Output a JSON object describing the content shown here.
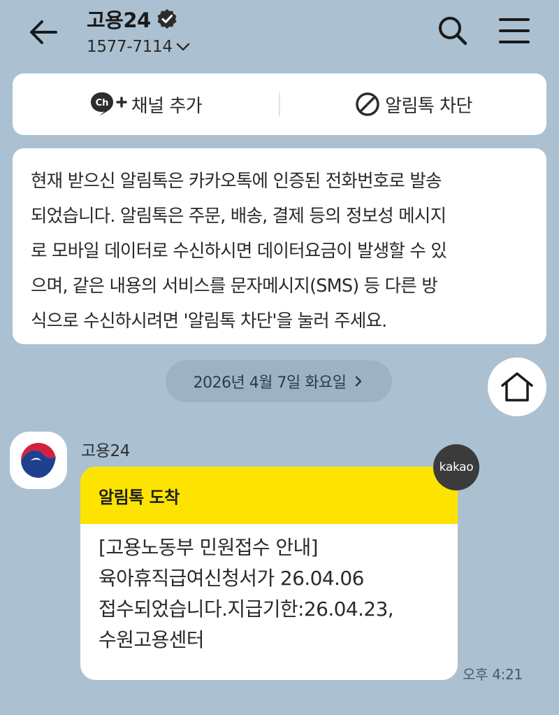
{
  "header": {
    "title": "고용24",
    "phone": "1577-7114"
  },
  "actions": {
    "add_channel": "채널 추가",
    "block": "알림톡 차단",
    "ch_badge": "Ch"
  },
  "notice": {
    "lines": [
      "현재 받으신 알림톡은 카카오톡에 인증된 전화번호로 발송",
      "되었습니다. 알림톡은 주문, 배송, 결제 등의 정보성 메시지",
      "로 모바일 데이터로 수신하시면 데이터요금이 발생할 수 있",
      "으며, 같은 내용의 서비스를 문자메시지(SMS) 등 다른 방",
      "식으로 수신하시려면 '알림톡 차단'을 눌러 주세요."
    ]
  },
  "date_divider": "2026년 4월 7일 화요일",
  "message": {
    "sender": "고용24",
    "header": "알림톡 도착",
    "lines": [
      "[고용노동부 민원접수 안내]",
      "육아휴직급여신청서가 26.04.06",
      "접수되었습니다.지급기한:26.04.23,",
      "수원고용센터"
    ],
    "badge": "kakao",
    "time": "오후 4:21"
  },
  "colors": {
    "background": "#abc1d1",
    "notice_header": "#fde400",
    "date_pill": "#9db3c4"
  },
  "icons": [
    "back-arrow-icon",
    "verified-badge-icon",
    "chevron-down-icon",
    "search-icon",
    "menu-icon",
    "channel-add-icon",
    "block-icon",
    "chevron-right-icon",
    "home-icon",
    "taegeuk-logo-icon"
  ]
}
